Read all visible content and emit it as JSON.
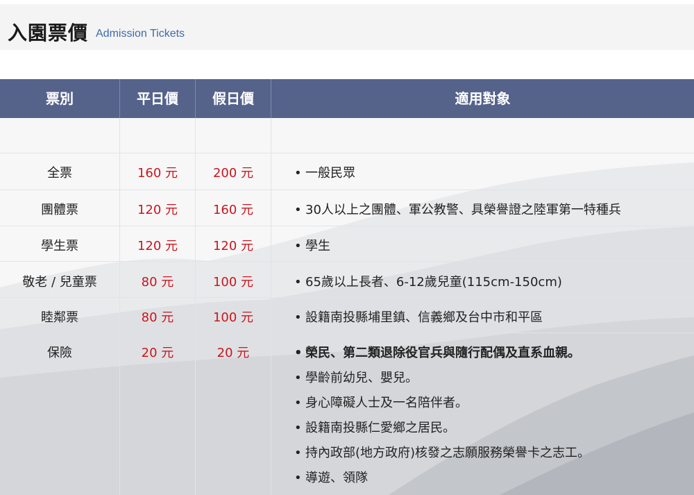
{
  "title": {
    "zh": "入園票價",
    "en": "Admission Tickets"
  },
  "table": {
    "headers": [
      "票別",
      "平日價",
      "假日價",
      "適用對象"
    ],
    "rows": [
      {
        "type": "全票",
        "weekday": "160 元",
        "holiday": "200 元",
        "targets": [
          "一般民眾"
        ]
      },
      {
        "type": "團體票",
        "weekday": "120 元",
        "holiday": "160 元",
        "targets": [
          "30人以上之團體、軍公教警、具榮譽證之陸軍第一特種兵"
        ]
      },
      {
        "type": "學生票",
        "weekday": "120 元",
        "holiday": "120 元",
        "targets": [
          "學生"
        ]
      },
      {
        "type": "敬老 / 兒童票",
        "weekday": "80 元",
        "holiday": "100 元",
        "targets": [
          "65歲以上長者、6-12歲兒童(115cm-150cm)"
        ]
      },
      {
        "type": "睦鄰票",
        "weekday": "80 元",
        "holiday": "100 元",
        "targets": [
          "設籍南投縣埔里鎮、信義鄉及台中市和平區"
        ]
      },
      {
        "type": "保險",
        "weekday": "20 元",
        "holiday": "20 元",
        "targets": [
          "榮民、第二類退除役官兵與隨行配偶及直系血親。",
          "學齡前幼兒、嬰兒。",
          "身心障礙人士及一名陪伴者。",
          "設籍南投縣仁愛鄉之居民。",
          "持內政部(地方政府)核發之志願服務榮譽卡之志工。",
          "導遊、領隊"
        ]
      }
    ]
  },
  "bullet_symbol": "•"
}
